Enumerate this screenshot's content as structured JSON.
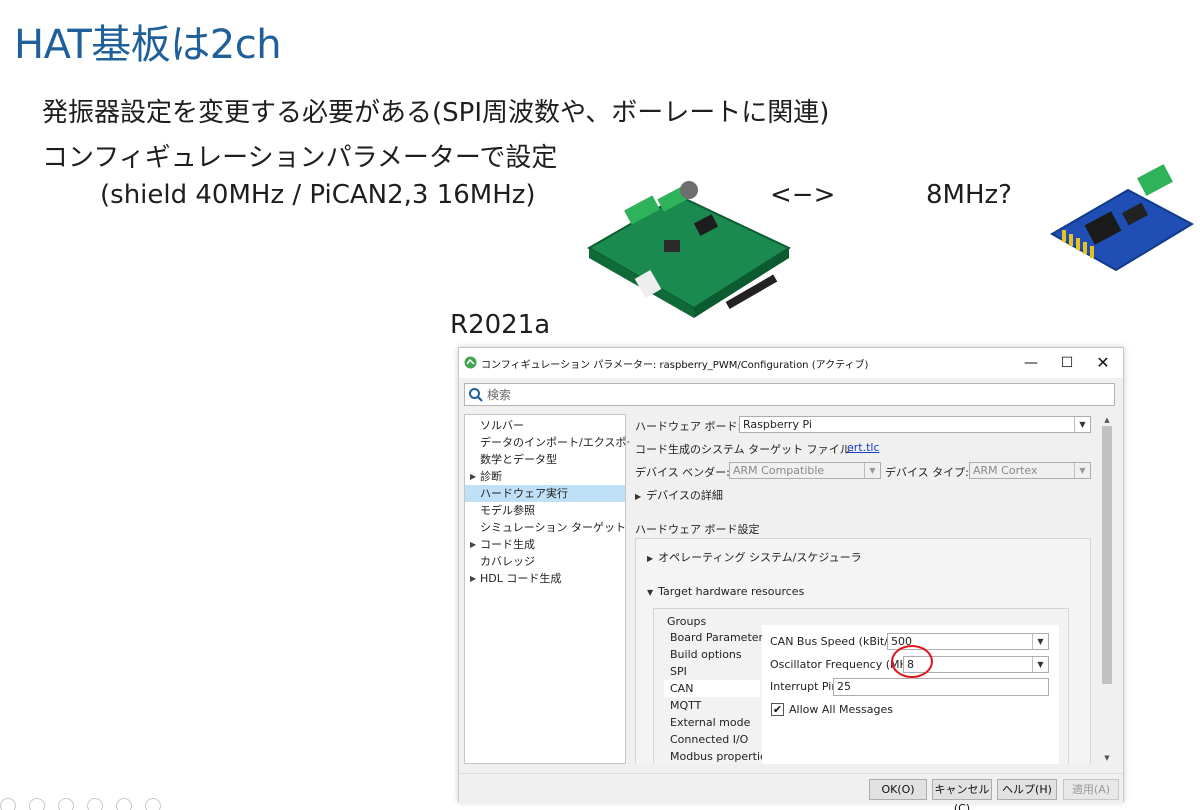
{
  "slide": {
    "title": "HAT基板は2ch",
    "line1": "発振器設定を変更する必要がある(SPI周波数や、ボーレートに関連)",
    "line2": "コンフィギュレーションパラメーターで設定",
    "line3": "(shield 40MHz / PiCAN2,3 16MHz)",
    "arrow": "<−>",
    "mhz": "8MHz?",
    "release": "R2021a"
  },
  "dialog": {
    "title": "コンフィギュレーション パラメーター: raspberry_PWM/Configuration (アクティブ)",
    "buttons": {
      "minimize": "—",
      "maximize": "☐",
      "close": "✕"
    },
    "search_placeholder": "検索",
    "tree": [
      {
        "label": "ソルバー",
        "caret": ""
      },
      {
        "label": "データのインポート/エクスポート",
        "caret": ""
      },
      {
        "label": "数学とデータ型",
        "caret": ""
      },
      {
        "label": "診断",
        "caret": "▶"
      },
      {
        "label": "ハードウェア実行",
        "caret": ""
      },
      {
        "label": "モデル参照",
        "caret": ""
      },
      {
        "label": "シミュレーション ターゲット",
        "caret": ""
      },
      {
        "label": "コード生成",
        "caret": "▶"
      },
      {
        "label": "カバレッジ",
        "caret": ""
      },
      {
        "label": "HDL コード生成",
        "caret": "▶"
      }
    ],
    "hardware_board_label": "ハードウェア ボード:",
    "hardware_board_value": "Raspberry Pi",
    "codegen_label": "コード生成のシステム ターゲット ファイル:",
    "codegen_link": "ert.tlc",
    "device_vendor_label": "デバイス ベンダー:",
    "device_vendor_value": "ARM Compatible",
    "device_type_label": "デバイス タイプ:",
    "device_type_value": "ARM Cortex",
    "device_details": "デバイスの詳細",
    "hw_settings_label": "ハードウェア ボード設定",
    "os_scheduler": "オペレーティング システム/スケジューラ",
    "target_resources": "Target hardware resources",
    "groups_label": "Groups",
    "groups": [
      "Board Parameters",
      "Build options",
      "SPI",
      "CAN",
      "MQTT",
      "External mode",
      "Connected I/O",
      "Modbus properties"
    ],
    "can_speed_label": "CAN Bus Speed (kBit/s):",
    "can_speed_value": "500",
    "osc_label": "Oscillator Frequency (MHz):",
    "osc_value": "8",
    "interrupt_label": "Interrupt Pin:",
    "interrupt_value": "25",
    "allow_all_label": "Allow All Messages",
    "allow_all_checked": "✔",
    "footer": {
      "ok": "OK(O)",
      "cancel": "キャンセル(C)",
      "help": "ヘルプ(H)",
      "apply": "適用(A)"
    }
  },
  "colors": {
    "title_blue": "#1f5f9a",
    "selection": "#bfe0f7",
    "highlight_circle": "#e0151b"
  }
}
